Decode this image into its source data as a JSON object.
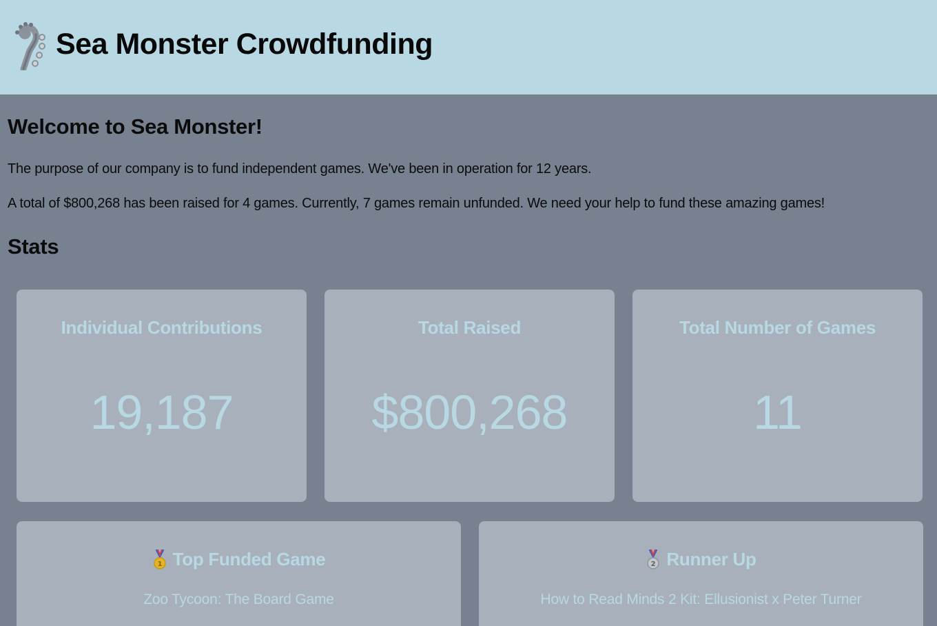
{
  "header": {
    "app_title": "Sea Monster Crowdfunding",
    "logo_icon": "tentacle-logo-icon"
  },
  "intro": {
    "title": "Welcome to Sea Monster!",
    "paragraph_1": "The purpose of our company is to fund independent games. We've been in operation for 12 years.",
    "paragraph_2": "A total of $800,268 has been raised for 4 games. Currently, 7 games remain unfunded. We need your help to fund these amazing games!"
  },
  "stats": {
    "title": "Stats",
    "cards": [
      {
        "label": "Individual Contributions",
        "value": "19,187"
      },
      {
        "label": "Total Raised",
        "value": "$800,268"
      },
      {
        "label": "Total Number of Games",
        "value": "11"
      }
    ],
    "top_funded": {
      "icon": "gold-medal-icon",
      "label": "Top Funded Game",
      "game": "Zoo Tycoon: The Board Game"
    },
    "runner_up": {
      "icon": "silver-medal-icon",
      "label": "Runner Up",
      "game": "How to Read Minds 2 Kit: Ellusionist x Peter Turner"
    }
  },
  "colors": {
    "header_bg": "#b8d8e4",
    "page_bg": "#778190",
    "card_bg": "#a8b0bc",
    "card_text": "#b8d8e4"
  }
}
